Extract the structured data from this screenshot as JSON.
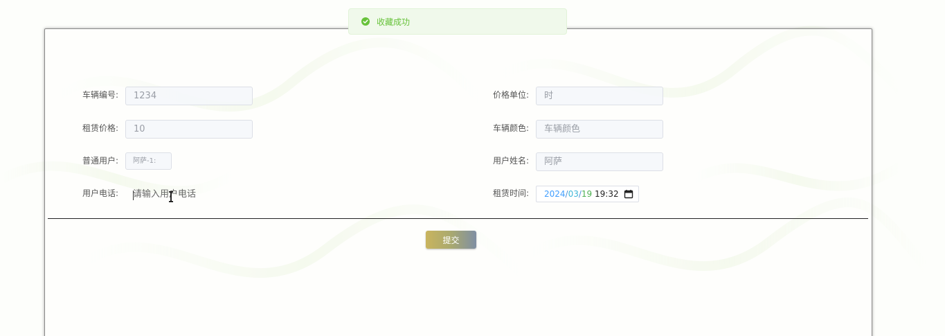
{
  "toast": {
    "message": "收藏成功",
    "icon": "check-circle-icon",
    "color": "#67c23a"
  },
  "form": {
    "vehicle_no": {
      "label": "车辆编号:",
      "value": "1234"
    },
    "price_unit": {
      "label": "价格单位:",
      "value": "时"
    },
    "rent_price": {
      "label": "租赁价格:",
      "value": "10"
    },
    "vehicle_color": {
      "label": "车辆颜色:",
      "placeholder": "车辆颜色"
    },
    "user": {
      "label": "普通用户:",
      "value": "阿萨-1:"
    },
    "user_name": {
      "label": "用户姓名:",
      "value": "阿萨"
    },
    "phone": {
      "label": "用户电话:",
      "placeholder": "请输入用户电话"
    },
    "rent_time": {
      "label": "租赁时间:",
      "year": "2024",
      "month": "03",
      "day": "19",
      "time": "19:32",
      "icon": "calendar-icon"
    }
  },
  "submit_label": "提交",
  "colors": {
    "accent_gold": "#c9b45e",
    "accent_blue": "#7f8fa3",
    "success": "#67c23a"
  }
}
